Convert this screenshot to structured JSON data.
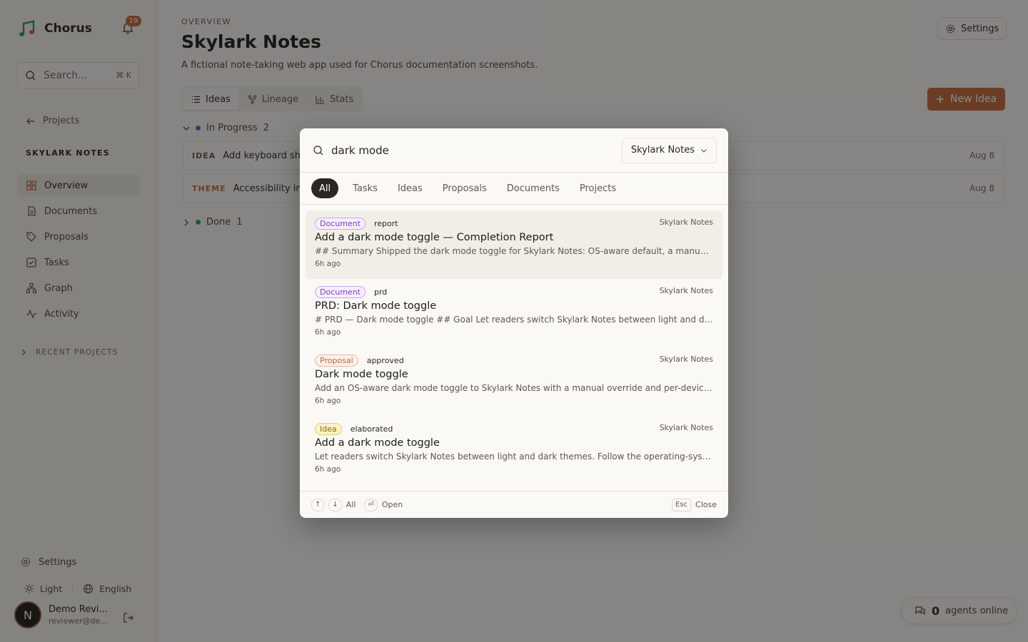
{
  "app": {
    "name": "Chorus",
    "notifications": "19"
  },
  "sidebar": {
    "search_placeholder": "Search...",
    "search_shortcut": "⌘ K",
    "back_label": "Projects",
    "project_heading": "SKYLARK NOTES",
    "nav": [
      {
        "label": "Overview",
        "icon": "grid-icon"
      },
      {
        "label": "Documents",
        "icon": "document-icon"
      },
      {
        "label": "Proposals",
        "icon": "tag-icon"
      },
      {
        "label": "Tasks",
        "icon": "checkbox-icon"
      },
      {
        "label": "Graph",
        "icon": "graph-icon"
      },
      {
        "label": "Activity",
        "icon": "activity-icon"
      }
    ],
    "recent_projects": "RECENT PROJECTS",
    "settings": "Settings",
    "theme": "Light",
    "language": "English",
    "user": {
      "initial": "N",
      "name": "Demo Revi...",
      "email": "reviewer@de..."
    }
  },
  "main": {
    "eyebrow": "OVERVIEW",
    "title": "Skylark Notes",
    "description": "A fictional note-taking web app used for Chorus documentation screenshots.",
    "settings_button": "Settings",
    "tabs": [
      {
        "label": "Ideas"
      },
      {
        "label": "Lineage"
      },
      {
        "label": "Stats"
      }
    ],
    "new_idea": "New Idea",
    "groups": [
      {
        "label": "In Progress",
        "count": "2",
        "color": "#3b6fd8"
      },
      {
        "label": "Done",
        "count": "1",
        "color": "#2e9a5a"
      }
    ],
    "rows": [
      {
        "kind": "IDEA",
        "title": "Add keyboard sho",
        "date": "Aug 8"
      },
      {
        "kind": "THEME",
        "title": "Accessibility im",
        "date": "Aug 8"
      }
    ],
    "agents": {
      "count": "0",
      "label": "agents online"
    }
  },
  "modal": {
    "query": "dark mode",
    "scope": "Skylark Notes",
    "filters": [
      "All",
      "Tasks",
      "Ideas",
      "Proposals",
      "Documents",
      "Projects"
    ],
    "results": [
      {
        "type": "Document",
        "status": "report",
        "project": "Skylark Notes",
        "title": "Add a dark mode toggle — Completion Report",
        "snippet": "## Summary Shipped the dark mode toggle for Skylark Notes: OS-aware default, a manual override and per-device persistence.",
        "time": "6h ago"
      },
      {
        "type": "Document",
        "status": "prd",
        "project": "Skylark Notes",
        "title": "PRD: Dark mode toggle",
        "snippet": "# PRD — Dark mode toggle ## Goal Let readers switch Skylark Notes between light and dark themes.",
        "time": "6h ago"
      },
      {
        "type": "Proposal",
        "status": "approved",
        "project": "Skylark Notes",
        "title": "Dark mode toggle",
        "snippet": "Add an OS-aware dark mode toggle to Skylark Notes with a manual override and per-device persistence.",
        "time": "6h ago"
      },
      {
        "type": "Idea",
        "status": "elaborated",
        "project": "Skylark Notes",
        "title": "Add a dark mode toggle",
        "snippet": "Let readers switch Skylark Notes between light and dark themes. Follow the operating-system setting by default.",
        "time": "6h ago"
      }
    ],
    "footer": {
      "up": "↑",
      "down": "↓",
      "nav_label": "All",
      "enter": "⏎",
      "open_label": "Open",
      "esc": "Esc",
      "close_label": "Close"
    }
  }
}
